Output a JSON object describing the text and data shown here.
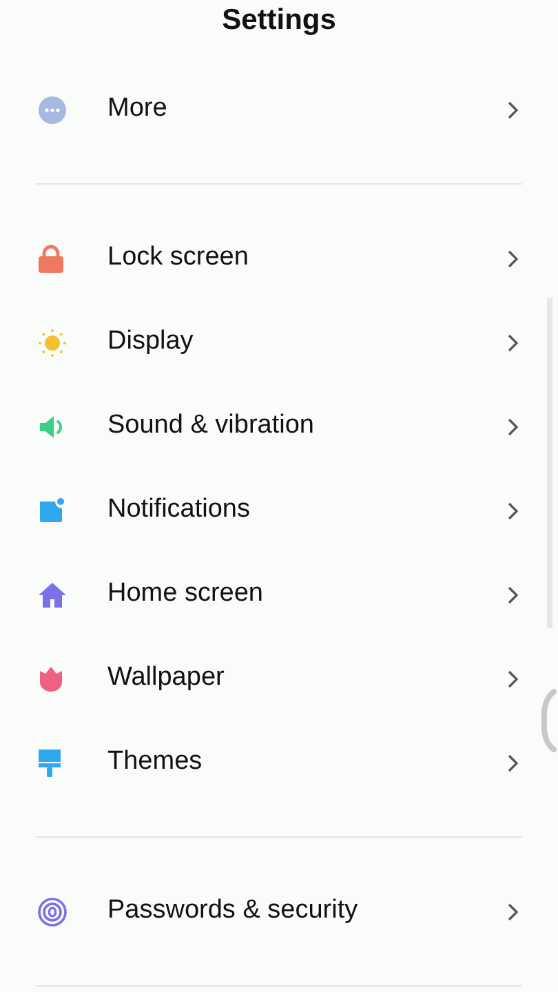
{
  "title": "Settings",
  "sections": [
    {
      "items": [
        {
          "label": "More"
        }
      ]
    },
    {
      "items": [
        {
          "label": "Lock screen"
        },
        {
          "label": "Display"
        },
        {
          "label": "Sound & vibration"
        },
        {
          "label": "Notifications"
        },
        {
          "label": "Home screen"
        },
        {
          "label": "Wallpaper"
        },
        {
          "label": "Themes"
        }
      ]
    },
    {
      "items": [
        {
          "label": "Passwords & security"
        }
      ]
    }
  ]
}
